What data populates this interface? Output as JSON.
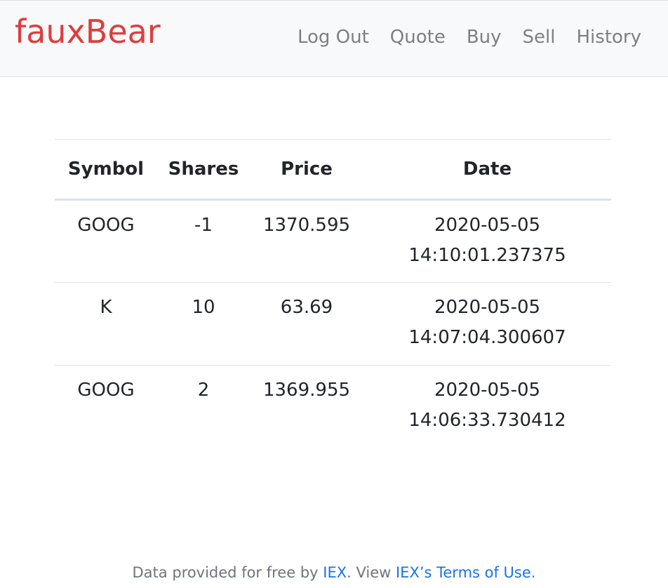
{
  "navbar": {
    "brand": "fauxBear",
    "links": [
      "Log Out",
      "Quote",
      "Buy",
      "Sell",
      "History"
    ]
  },
  "table": {
    "headers": [
      "Symbol",
      "Shares",
      "Price",
      "Date"
    ],
    "rows": [
      {
        "symbol": "GOOG",
        "shares": "-1",
        "price": "1370.595",
        "date": "2020-05-05",
        "time": "14:10:01.237375"
      },
      {
        "symbol": "K",
        "shares": "10",
        "price": "63.69",
        "date": "2020-05-05",
        "time": "14:07:04.300607"
      },
      {
        "symbol": "GOOG",
        "shares": "2",
        "price": "1369.955",
        "date": "2020-05-05",
        "time": "14:06:33.730412"
      }
    ]
  },
  "footer": {
    "prefix": "Data provided for free by ",
    "iex_link": "IEX",
    "middle": ". View ",
    "terms_link": "IEX’s Terms of Use",
    "suffix": "."
  },
  "colors": {
    "brand": "#e03c3c",
    "nav_link": "#7f7f7f",
    "link": "#1a73e8",
    "navbar_bg": "#f8f9fa"
  }
}
